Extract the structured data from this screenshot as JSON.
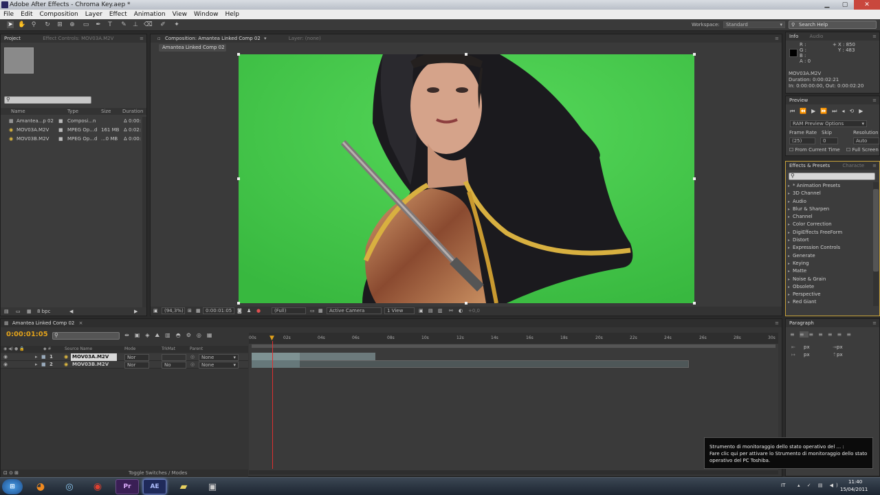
{
  "window": {
    "title": "Adobe After Effects - Chroma Key.aep *"
  },
  "menu": [
    "File",
    "Edit",
    "Composition",
    "Layer",
    "Effect",
    "Animation",
    "View",
    "Window",
    "Help"
  ],
  "toolbar": {
    "workspace_label": "Workspace:",
    "workspace_value": "Standard",
    "search_placeholder": "Search Help"
  },
  "project": {
    "tab_project": "Project",
    "tab_effect_controls": "Effect Controls: MOV03A.M2V",
    "columns": [
      "Name",
      "Type",
      "Size",
      "Duration"
    ],
    "items": [
      {
        "name": "Amantea...p 02",
        "type": "Composi...n",
        "size": "",
        "duration": "Δ 0:00:"
      },
      {
        "name": "MOV03A.M2V",
        "type": "MPEG Op...d",
        "size": "161 MB",
        "duration": "Δ 0:02:"
      },
      {
        "name": "MOV03B.M2V",
        "type": "MPEG Op...d",
        "size": "...0 MB",
        "duration": "Δ 0:00:"
      }
    ],
    "bpc": "8 bpc"
  },
  "composition": {
    "tab_label": "Composition: Amantea Linked Comp 02",
    "layer_tab": "Layer: (none)",
    "breadcrumb": "Amantea Linked Comp 02",
    "zoom": "(94,3%)",
    "timecode": "0:00:01:05",
    "resolution": "(Full)",
    "camera": "Active Camera",
    "views": "1 View",
    "exposure": "+0,0"
  },
  "info": {
    "tab_info": "Info",
    "tab_audio": "Audio",
    "r": "R :",
    "g": "G :",
    "b": "B :",
    "a": "A : 0",
    "x": "X : 850",
    "y": "Y : 483",
    "file": "MOV03A.M2V",
    "duration": "Duration: 0:00:02:21",
    "in_out": "In: 0:00:00:00, Out: 0:00:02:20"
  },
  "preview": {
    "tab": "Preview",
    "ram_options": "RAM Preview Options",
    "frame_rate_label": "Frame Rate",
    "skip_label": "Skip",
    "resolution_label": "Resolution",
    "frame_rate": "(25)",
    "skip": "0",
    "resolution": "Auto",
    "from_current": "From Current Time",
    "full_screen": "Full Screen"
  },
  "effects": {
    "tab": "Effects & Presets",
    "tab2": "Characte",
    "items": [
      "* Animation Presets",
      "3D Channel",
      "Audio",
      "Blur & Sharpen",
      "Channel",
      "Color Correction",
      "DigiEffects FreeForm",
      "Distort",
      "Expression Controls",
      "Generate",
      "Keying",
      "Matte",
      "Noise & Grain",
      "Obsolete",
      "Perspective",
      "Red Giant"
    ]
  },
  "paragraph": {
    "tab": "Paragraph",
    "px1": "px",
    "px2": "px",
    "px3": "px",
    "px4": "px"
  },
  "timeline": {
    "tab": "Amantea Linked Comp 02",
    "timecode": "0:00:01:05",
    "columns": {
      "source": "Source Name",
      "mode": "Mode",
      "trkmat": "TrkMat",
      "parent": "Parent"
    },
    "ticks": [
      "00s",
      "02s",
      "04s",
      "06s",
      "08s",
      "10s",
      "12s",
      "14s",
      "16s",
      "18s",
      "20s",
      "22s",
      "24s",
      "26s",
      "28s",
      "30s"
    ],
    "layers": [
      {
        "num": "1",
        "name": "MOV03A.M2V",
        "mode": "Nor",
        "trkmat": "",
        "parent": "None"
      },
      {
        "num": "2",
        "name": "MOV03B.M2V",
        "mode": "Nor",
        "trkmat": "No",
        "parent": "None"
      }
    ],
    "toggle": "Toggle Switches / Modes"
  },
  "notification": {
    "title": "Strumento di monitoraggio dello stato operativo del ... :",
    "body": "Fare clic qui per attivare lo Strumento di monitoraggio dello stato operativo del PC Toshiba."
  },
  "taskbar": {
    "apps": [
      "start-orb",
      "firefox",
      "network",
      "chrome",
      "premiere",
      "after-effects",
      "folder",
      "media"
    ],
    "lang": "IT",
    "time": "11:40",
    "date": "15/04/2011"
  },
  "colors": {
    "greenscreen": "#43c84a",
    "playhead": "#e03030",
    "timecode": "#e2a21b"
  }
}
